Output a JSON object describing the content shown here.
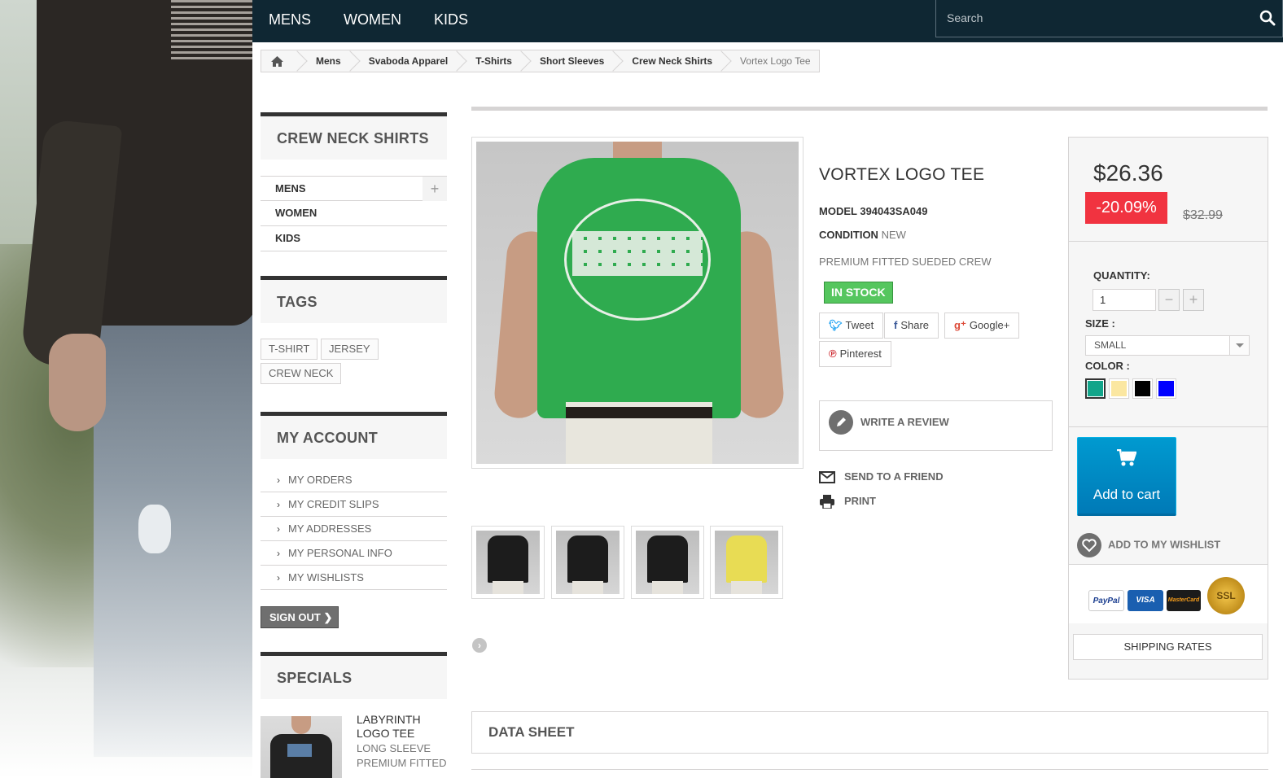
{
  "nav": {
    "items": [
      "MENS",
      "WOMEN",
      "KIDS"
    ],
    "search_placeholder": "Search"
  },
  "breadcrumb": [
    "Mens",
    "Svaboda Apparel",
    "T-Shirts",
    "Short Sleeves",
    "Crew Neck Shirts",
    "Vortex Logo Tee"
  ],
  "sidebar": {
    "category_title": "CREW NECK SHIRTS",
    "categories": [
      "MENS",
      "WOMEN",
      "KIDS"
    ],
    "tags_title": "TAGS",
    "tags": [
      "T-SHIRT",
      "JERSEY",
      "CREW NECK"
    ],
    "account_title": "MY ACCOUNT",
    "account_links": [
      "MY ORDERS",
      "MY CREDIT SLIPS",
      "MY ADDRESSES",
      "MY PERSONAL INFO",
      "MY WISHLISTS"
    ],
    "sign_out": "SIGN OUT",
    "specials_title": "SPECIALS",
    "special": {
      "name": "LABYRINTH LOGO TEE",
      "desc": "LONG SLEEVE PREMIUM FITTED"
    }
  },
  "product": {
    "title": "VORTEX LOGO TEE",
    "model_label": "MODEL",
    "model": "394043SA049",
    "condition_label": "CONDITION",
    "condition": "NEW",
    "description": "PREMIUM FITTED SUEDED CREW",
    "stock": "IN STOCK",
    "social": [
      "Tweet",
      "Share",
      "Google+",
      "Pinterest"
    ],
    "write_review": "WRITE A REVIEW",
    "send_friend": "SEND TO A FRIEND",
    "print": "PRINT",
    "thumb_colors": [
      "#1c1c1c",
      "#1c1c1c",
      "#1c1c1c",
      "#e8dc54"
    ]
  },
  "buy": {
    "price": "$26.36",
    "discount": "-20.09%",
    "old_price": "$32.99",
    "quantity_label": "QUANTITY:",
    "quantity": "1",
    "size_label": "SIZE :",
    "size": "SMALL",
    "color_label": "COLOR :",
    "colors": [
      "#12a58a",
      "#fbe7a1",
      "#000000",
      "#0000ff"
    ],
    "add_to_cart": "Add to cart",
    "wishlist": "ADD TO MY WISHLIST",
    "payments": [
      "PayPal",
      "VISA",
      "MasterCard",
      "SSL"
    ],
    "shipping": "SHIPPING RATES"
  },
  "datasheet_title": "DATA SHEET"
}
